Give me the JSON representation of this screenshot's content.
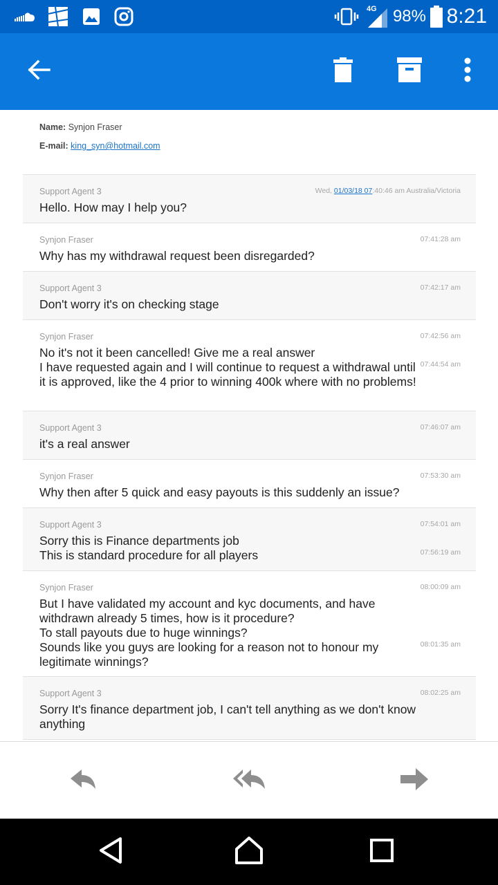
{
  "status_bar": {
    "network": "4G",
    "battery": "98%",
    "time": "8:21"
  },
  "icons": {
    "back": "arrow-left-icon",
    "delete": "trash-icon",
    "archive": "archive-icon",
    "more": "more-vertical-icon",
    "reply": "reply-icon",
    "reply_all": "reply-all-icon",
    "forward": "forward-icon"
  },
  "colors": {
    "status_bar": "#0063c5",
    "app_bar": "#0a78dc",
    "link": "#1a73c8"
  },
  "contact": {
    "name_label": "Name:",
    "name_value": "Synjon Fraser",
    "email_label": "E-mail:",
    "email_value": "king_syn@hotmail.com"
  },
  "messages": [
    {
      "sender": "Support Agent 3",
      "header_prefix": "Wed, ",
      "header_date": "01/03/18 07",
      "header_suffix": ":40:46 am Australia/Victoria",
      "text": "Hello. How may I help you?"
    },
    {
      "sender": "Synjon Fraser",
      "time": "07:41:28 am",
      "text": "Why has my withdrawal request been disregarded?"
    },
    {
      "sender": "Support Agent 3",
      "time": "07:42:17 am",
      "text": "Don't worry it's on checking stage"
    },
    {
      "sender": "Synjon Fraser",
      "time": "07:42:56 am",
      "time2": "07:44:54 am",
      "text": "No it's not it been cancelled! Give me a real answer",
      "text2": "I have requested again and I will continue to request a withdrawal until it is approved, like the 4 prior to winning 400k where with no problems!"
    },
    {
      "sender": "Support Agent 3",
      "time": "07:46:07 am",
      "text": "it's a real answer"
    },
    {
      "sender": "Synjon Fraser",
      "time": "07:53:30 am",
      "text": "Why then after 5 quick and easy payouts is this suddenly an issue?"
    },
    {
      "sender": "Support Agent 3",
      "time": "07:54:01 am",
      "time2": "07:56:19 am",
      "text": "Sorry this is Finance departments job",
      "text2": "This is standard procedure for all players"
    },
    {
      "sender": "Synjon Fraser",
      "time": "08:00:09 am",
      "time2": "08:01:35 am",
      "text": "But I have validated my account and kyc documents, and have withdrawn already 5 times, how is it procedure?\nTo stall payouts due to huge winnings?",
      "text2": "Sounds like you guys are looking for a reason not to honour my legitimate winnings?"
    },
    {
      "sender": "Support Agent 3",
      "time": "08:02:25 am",
      "text": "Sorry It's finance department job, I can't tell anything as we don't know anything"
    }
  ]
}
